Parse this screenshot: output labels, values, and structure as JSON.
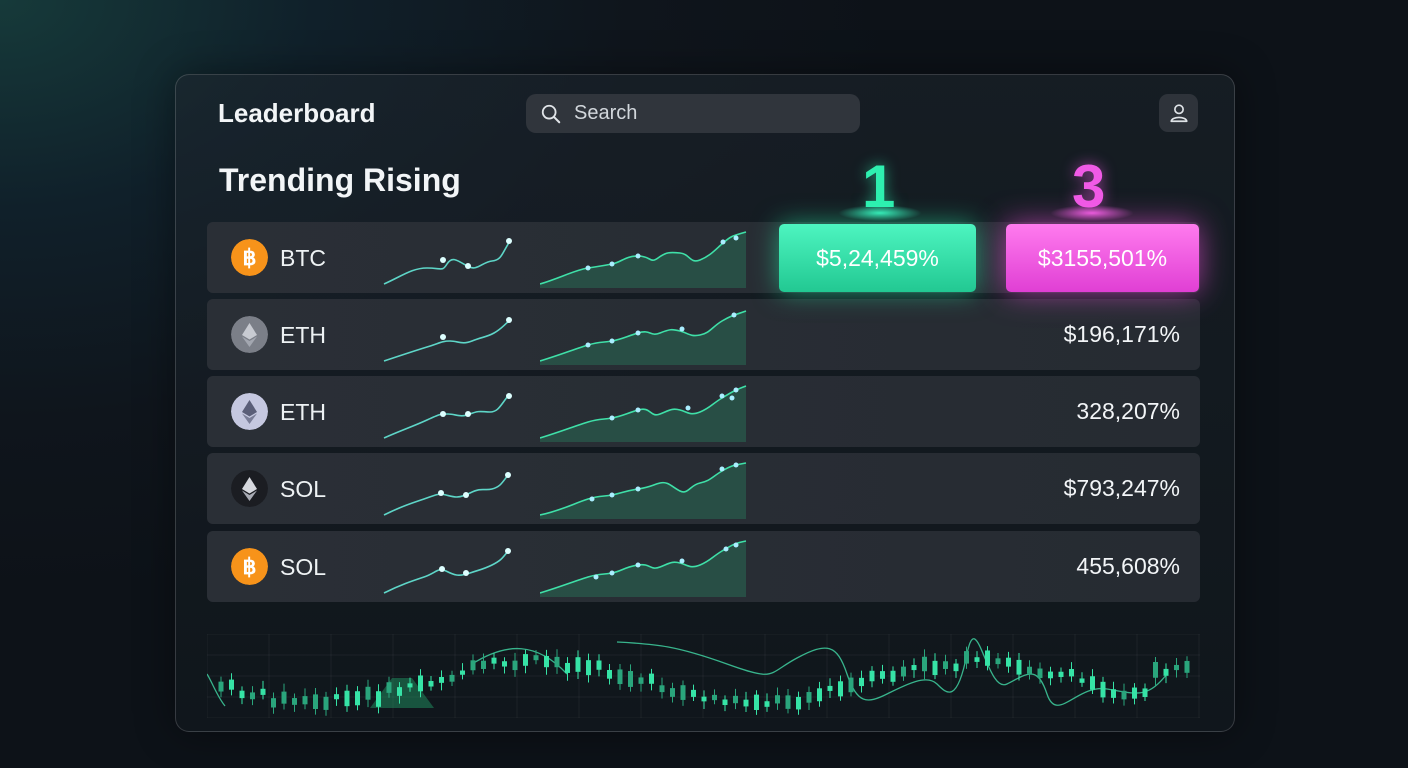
{
  "header": {
    "app_title": "Leaderboard",
    "search_placeholder": "Search"
  },
  "section_title": "Trending Rising",
  "ranks": [
    "1",
    "3"
  ],
  "rows": [
    {
      "symbol": "BTC",
      "coin_icon": "bitcoin-icon",
      "value_green": "$5,24,459%",
      "value_pink": "$3155,501%"
    },
    {
      "symbol": "ETH",
      "coin_icon": "ethereum-grey-icon",
      "value": "$196,171%"
    },
    {
      "symbol": "ETH",
      "coin_icon": "ethereum-icon",
      "value": "328,207%"
    },
    {
      "symbol": "SOL",
      "coin_icon": "ethereum-dark-icon",
      "value": "$793,247%"
    },
    {
      "symbol": "SOL",
      "coin_icon": "bitcoin-icon",
      "value": "455,608%"
    }
  ],
  "colors": {
    "accent_green": "#2ef0b0",
    "accent_pink": "#f05ae6",
    "bitcoin_orange": "#f7931a"
  }
}
